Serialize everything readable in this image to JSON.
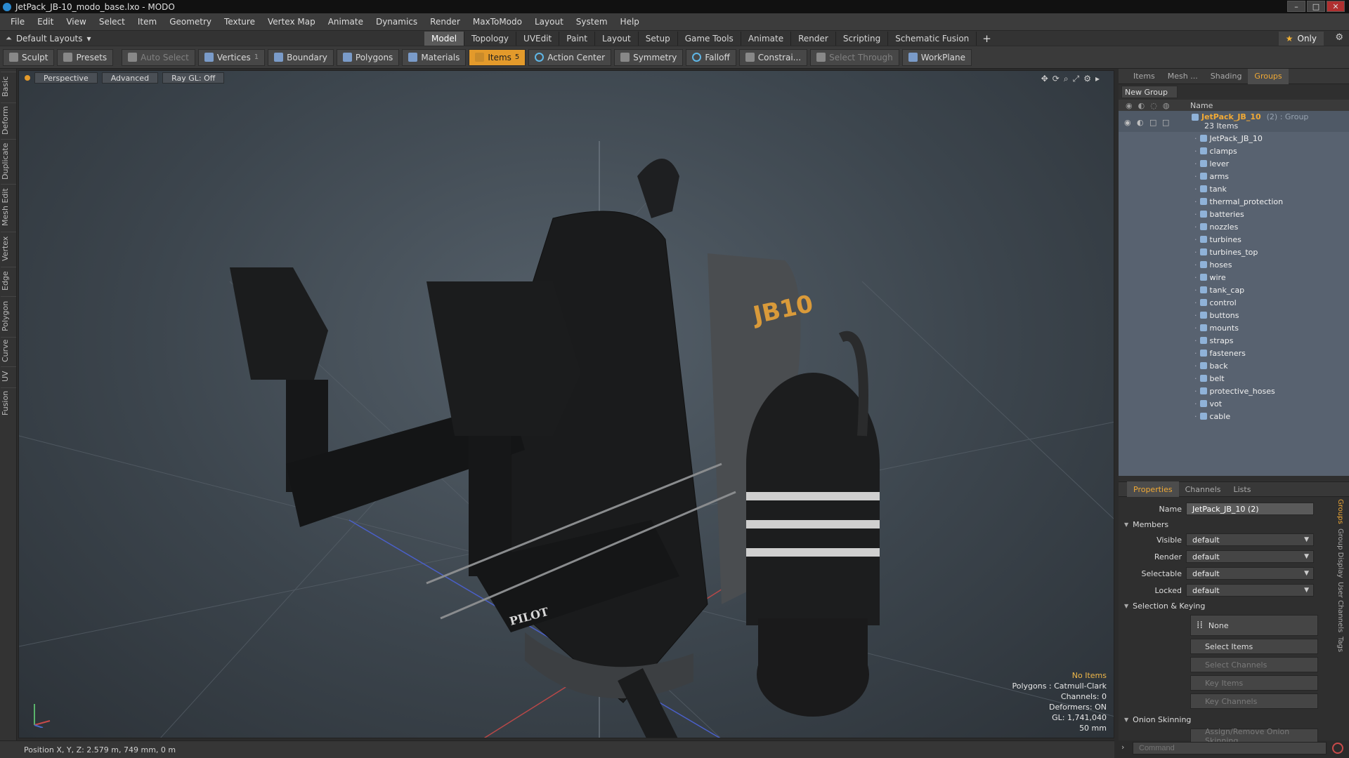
{
  "window": {
    "title": "JetPack_JB-10_modo_base.lxo - MODO"
  },
  "menu": [
    "File",
    "Edit",
    "View",
    "Select",
    "Item",
    "Geometry",
    "Texture",
    "Vertex Map",
    "Animate",
    "Dynamics",
    "Render",
    "MaxToModo",
    "Layout",
    "System",
    "Help"
  ],
  "layout_bar": {
    "layouts_label": "Default Layouts",
    "tabs": [
      "Model",
      "Topology",
      "UVEdit",
      "Paint",
      "Layout",
      "Setup",
      "Game Tools",
      "Animate",
      "Render",
      "Scripting",
      "Schematic Fusion"
    ],
    "active_tab": "Model",
    "only_label": "Only"
  },
  "toolbar": {
    "sculpt": "Sculpt",
    "presets": "Presets",
    "auto_select": "Auto Select",
    "vertices": "Vertices",
    "vertices_count": "1",
    "boundary": "Boundary",
    "polygons": "Polygons",
    "materials": "Materials",
    "items": "Items",
    "items_count": "5",
    "action_center": "Action Center",
    "symmetry": "Symmetry",
    "falloff": "Falloff",
    "constraints": "Constrai...",
    "select_through": "Select Through",
    "workplane": "WorkPlane"
  },
  "left_tabs": [
    "Basic",
    "Deform",
    "Duplicate",
    "Mesh Edit",
    "Vertex",
    "Edge",
    "Polygon",
    "Curve",
    "UV",
    "Fusion"
  ],
  "viewport": {
    "view_mode": "Perspective",
    "shading": "Advanced",
    "raygl": "Ray GL: Off",
    "info": {
      "selection": "No Items",
      "polygons": "Polygons : Catmull-Clark",
      "channels": "Channels: 0",
      "deformers": "Deformers: ON",
      "gl": "GL: 1,741,040",
      "focal": "50 mm"
    },
    "model_labels": {
      "pilot": "PILOT",
      "jb": "JB10"
    }
  },
  "right_panel": {
    "tabs": [
      "Items",
      "Mesh ...",
      "Shading",
      "Groups"
    ],
    "active_tab": "Groups",
    "new_group": "New Group",
    "column_name": "Name",
    "group": {
      "name": "JetPack_JB_10",
      "suffix": "(2) : Group",
      "count": "23 Items"
    },
    "members": [
      "JetPack_JB_10",
      "clamps",
      "lever",
      "arms",
      "tank",
      "thermal_protection",
      "batteries",
      "nozzles",
      "turbines",
      "turbines_top",
      "hoses",
      "wire",
      "tank_cap",
      "control",
      "buttons",
      "mounts",
      "straps",
      "fasteners",
      "back",
      "belt",
      "protective_hoses",
      "vot",
      "cable"
    ]
  },
  "properties": {
    "tabs": [
      "Properties",
      "Channels",
      "Lists"
    ],
    "active_tab": "Properties",
    "name_label": "Name",
    "name_value": "JetPack_JB_10 (2)",
    "members_section": "Members",
    "fields": [
      {
        "label": "Visible",
        "value": "default"
      },
      {
        "label": "Render",
        "value": "default"
      },
      {
        "label": "Selectable",
        "value": "default"
      },
      {
        "label": "Locked",
        "value": "default"
      }
    ],
    "selection_section": "Selection & Keying",
    "none_label": "None",
    "select_items": "Select Items",
    "select_channels": "Select Channels",
    "key_items": "Key Items",
    "key_channels": "Key Channels",
    "onion_section": "Onion Skinning",
    "onion_button": "Assign/Remove Onion Skinning",
    "side_tabs": [
      "Groups",
      "Group Display",
      "User Channels",
      "Tags"
    ]
  },
  "command": {
    "placeholder": "Command"
  },
  "status": {
    "position": "Position X, Y, Z:  2.579 m, 749 mm, 0 m"
  },
  "colors": {
    "accent": "#e39a2b",
    "selection": "#586270",
    "background": "#2b2b2b"
  }
}
